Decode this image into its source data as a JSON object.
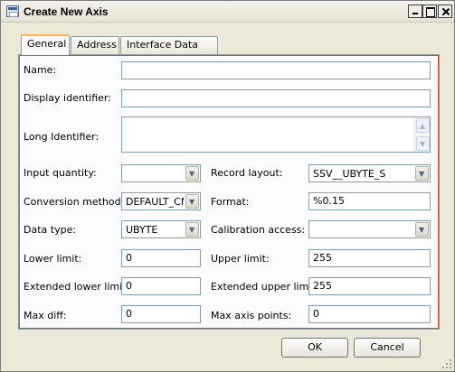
{
  "window": {
    "title": "Create New Axis"
  },
  "tabs": [
    {
      "label": "General",
      "active": true
    },
    {
      "label": "Address",
      "active": false
    },
    {
      "label": "Interface Data",
      "active": false
    }
  ],
  "fields": {
    "name": {
      "label": "Name:",
      "value": ""
    },
    "display_identifier": {
      "label": "Display identifier:",
      "value": ""
    },
    "long_identifier": {
      "label": "Long Identifier:",
      "value": ""
    },
    "input_quantity": {
      "label": "Input quantity:",
      "value": ""
    },
    "record_layout": {
      "label": "Record layout:",
      "value": "SSV__UBYTE_S"
    },
    "conversion_method": {
      "label": "Conversion method:",
      "value": "DEFAULT_CM"
    },
    "format": {
      "label": "Format:",
      "value": "%0.15"
    },
    "data_type": {
      "label": "Data type:",
      "value": "UBYTE"
    },
    "calibration_access": {
      "label": "Calibration access:",
      "value": ""
    },
    "lower_limit": {
      "label": "Lower limit:",
      "value": "0"
    },
    "upper_limit": {
      "label": "Upper limit:",
      "value": "255"
    },
    "extended_lower_limit": {
      "label": "Extended lower limit:",
      "value": "0"
    },
    "extended_upper_limit": {
      "label": "Extended upper limit:",
      "value": "255"
    },
    "max_diff": {
      "label": "Max diff:",
      "value": "0"
    },
    "max_axis_points": {
      "label": "Max axis points:",
      "value": "0"
    }
  },
  "buttons": {
    "ok": "OK",
    "cancel": "Cancel"
  },
  "icons": {
    "app": "app-window-icon",
    "minimize": "minimize-icon",
    "maximize": "maximize-icon",
    "close": "close-icon",
    "dropdown": "chevron-down-icon",
    "scroll_up": "scroll-up-icon",
    "scroll_down": "scroll-down-icon",
    "resize": "resize-grip-icon"
  },
  "colors": {
    "dialog_bg": "#ece9d8",
    "panel_bg": "#fcfcfe",
    "active_tab_accent": "#f7b74c",
    "input_border": "#7f9db9",
    "panel_focus_border": "#c05a3a"
  }
}
